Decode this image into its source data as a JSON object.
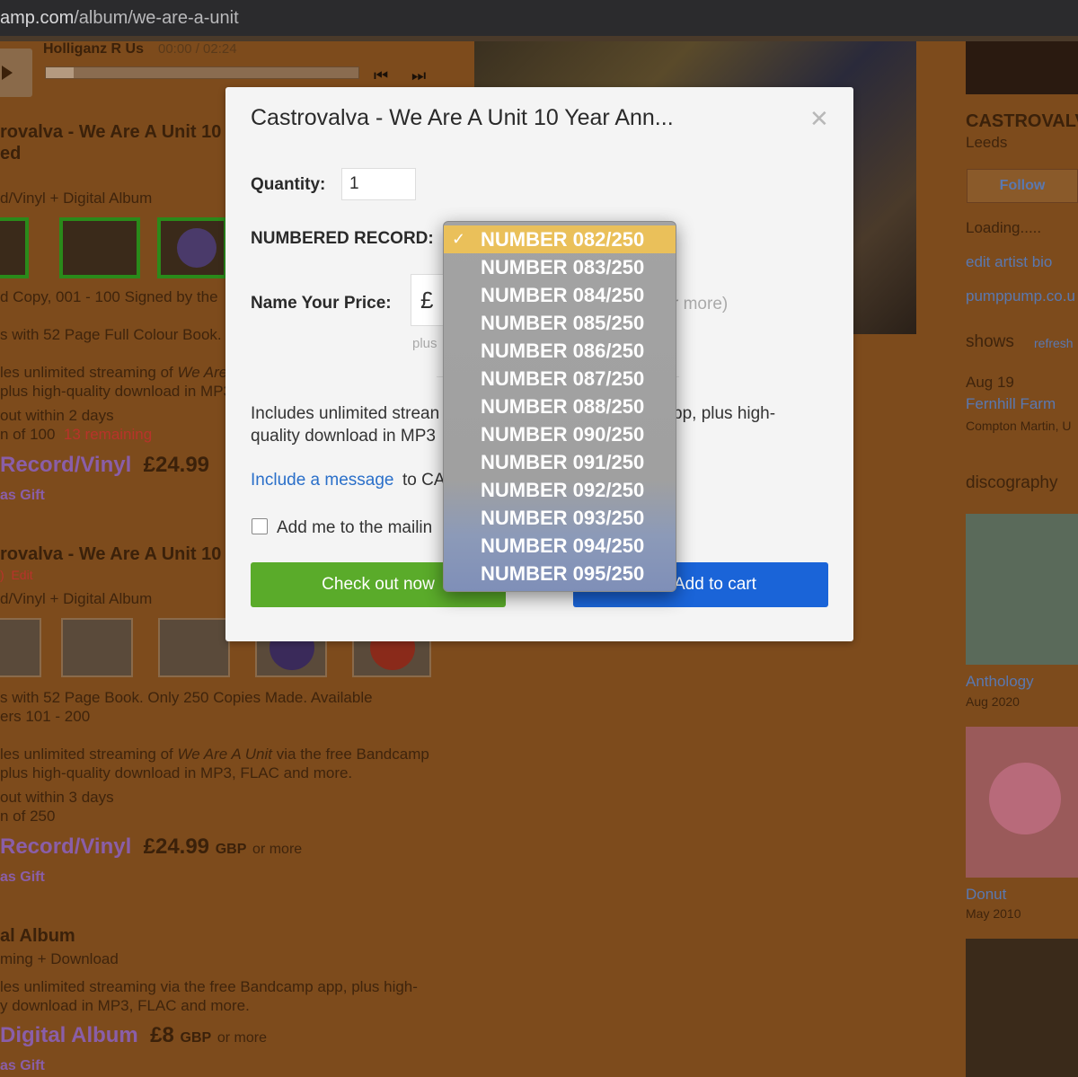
{
  "browser": {
    "url_host": "amp.com",
    "url_path": "/album/we-are-a-unit"
  },
  "player": {
    "track": "Holliganz R Us",
    "time": "00:00 / 02:24",
    "progress": 0.09
  },
  "background": {
    "package1": {
      "title": "rovalva - We Are A Unit 10 Y",
      "title2": "ed",
      "type": "d/Vinyl + Digital Album",
      "desc1": "d Copy, 001 - 100 Signed by the",
      "desc2": "s with 52 Page Full Colour Book.",
      "stream1": "les unlimited streaming of",
      "stream1_em": "We Are",
      "stream2": "plus high-quality download in MP3",
      "ships": "out within 2 days",
      "edition": "n of 100",
      "remaining": "13 remaining",
      "buy": "Record/Vinyl",
      "price": "£24.99",
      "gift": "as Gift"
    },
    "package2": {
      "title": "rovalva - We Are A Unit 10 Y",
      "edit_prefix": ")",
      "edit": "Edit",
      "type": "d/Vinyl + Digital Album",
      "desc1": "s with 52 Page Book. Only 250 Copies Made. Available",
      "desc2": "ers 101 - 200",
      "stream1": "les unlimited streaming of",
      "stream1_em": "We Are A Unit",
      "stream1_tail": "via the free Bandcamp",
      "stream2": "plus high-quality download in MP3, FLAC and more.",
      "ships": "out within 3 days",
      "edition": "n of 250",
      "buy": "Record/Vinyl",
      "price": "£24.99",
      "currency": "GBP",
      "more": "or more",
      "gift": "as Gift"
    },
    "package3": {
      "title": "al Album",
      "type": "ming + Download",
      "stream1": "les unlimited streaming via the free Bandcamp app, plus high-",
      "stream2": "y download in MP3, FLAC and more.",
      "buy": "Digital Album",
      "price": "£8",
      "currency": "GBP",
      "more": "or more",
      "gift": "as Gift"
    },
    "right": {
      "artist": "CASTROVALV",
      "location": "Leeds",
      "follow": "Follow",
      "loading": "Loading.....",
      "edit_bio": "edit artist bio",
      "site": "pumppump.co.u",
      "shows": "shows",
      "refresh": "refresh",
      "show_date": "Aug 19",
      "show_venue": "Fernhill Farm",
      "show_place": "Compton Martin, U",
      "discography": "discography",
      "disc1_title": "Anthology",
      "disc1_date": "Aug 2020",
      "disc2_title": "Donut",
      "disc2_date": "May 2010"
    }
  },
  "modal": {
    "title": "Castrovalva - We Are A Unit 10 Year Ann...",
    "quantity_label": "Quantity:",
    "quantity_value": "1",
    "numbered_label": "NUMBERED RECORD:",
    "price_label": "Name Your Price:",
    "currency_symbol": "£",
    "or_more": "r more)",
    "plus": "plus",
    "desc_line1": "Includes unlimited strean",
    "desc_line1_tail": "pp, plus high-",
    "desc_line2": "quality download in MP3",
    "include_link": "Include a message",
    "include_after": "to CA",
    "mailing": "Add me to the mailin",
    "checkout": "Check out now",
    "add_to_cart": "Add to cart"
  },
  "dropdown": {
    "selected_index": 0,
    "options": [
      "NUMBER 082/250",
      "NUMBER 083/250",
      "NUMBER 084/250",
      "NUMBER 085/250",
      "NUMBER 086/250",
      "NUMBER 087/250",
      "NUMBER 088/250",
      "NUMBER 090/250",
      "NUMBER 091/250",
      "NUMBER 092/250",
      "NUMBER 093/250",
      "NUMBER 094/250",
      "NUMBER 095/250"
    ]
  }
}
